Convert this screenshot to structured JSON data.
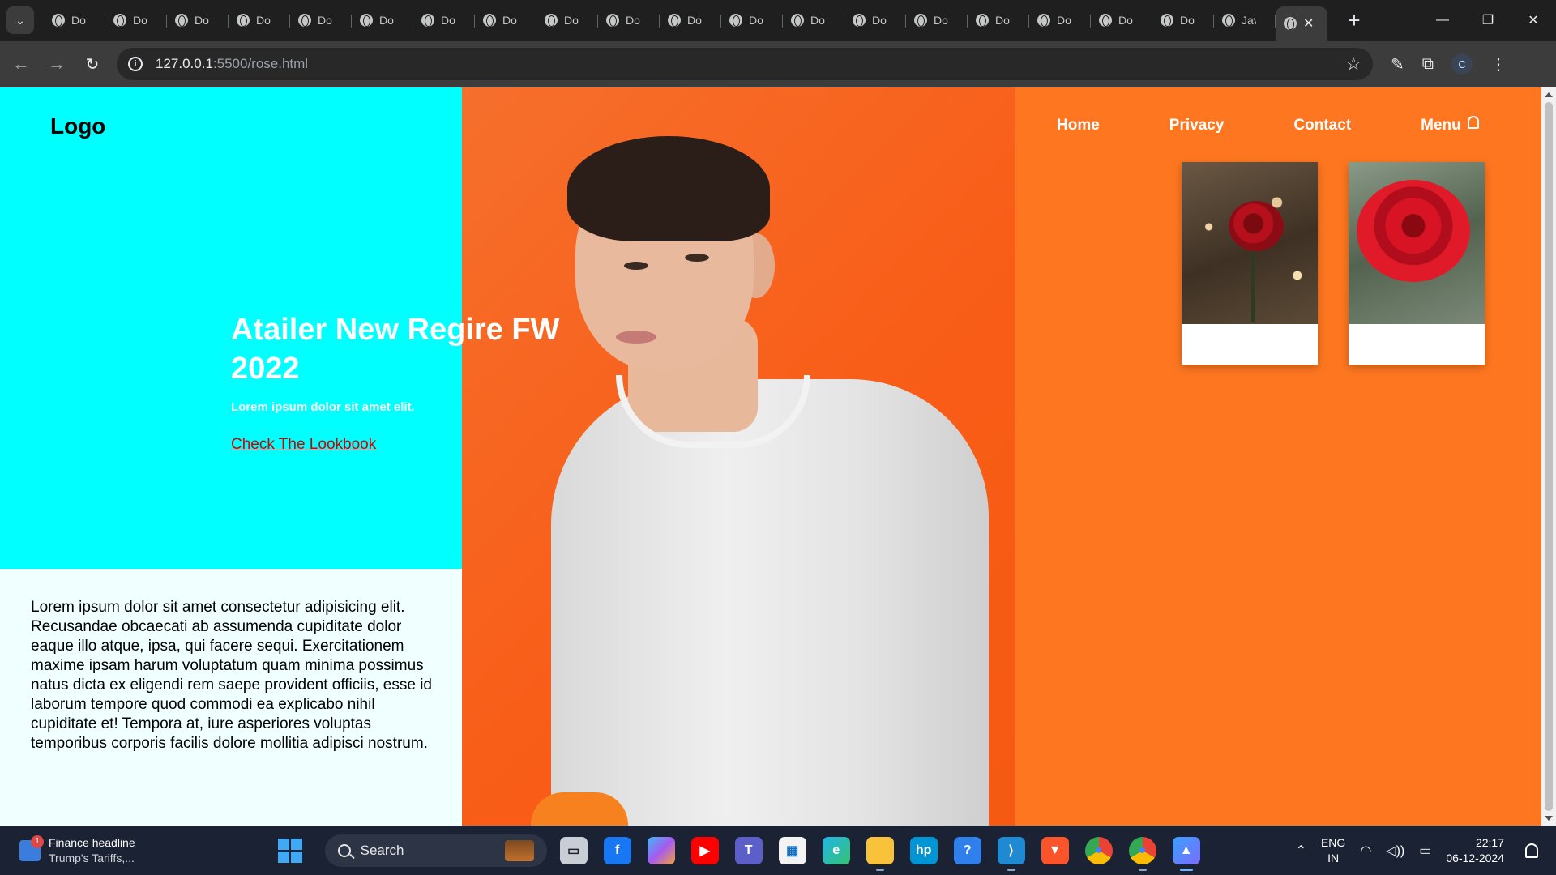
{
  "browser": {
    "tabs": [
      {
        "label": "Do"
      },
      {
        "label": "Do"
      },
      {
        "label": "Do"
      },
      {
        "label": "Do"
      },
      {
        "label": "Do"
      },
      {
        "label": "Do"
      },
      {
        "label": "Do"
      },
      {
        "label": "Do"
      },
      {
        "label": "Do"
      },
      {
        "label": "Do"
      },
      {
        "label": "Do"
      },
      {
        "label": "Do"
      },
      {
        "label": "Do"
      },
      {
        "label": "Do"
      },
      {
        "label": "Do"
      },
      {
        "label": "Do"
      },
      {
        "label": "Do"
      },
      {
        "label": "Do"
      },
      {
        "label": "Do"
      },
      {
        "label": "Jav"
      }
    ],
    "active_tab_close": "✕",
    "new_tab": "+",
    "url_host": "127.0.0.1",
    "url_rest": ":5500/rose.html",
    "profile_initial": "C"
  },
  "page": {
    "logo": "Logo",
    "nav": {
      "home": "Home",
      "privacy": "Privacy",
      "contact": "Contact",
      "menu": "Menu"
    },
    "hero": {
      "title": "Atailer New Regire FW 2022",
      "subtitle": "Lorem ipsum dolor sit amet elit.",
      "link": "Check The Lookbook"
    },
    "paragraph": "Lorem ipsum dolor sit amet consectetur adipisicing elit. Recusandae obcaecati ab assumenda cupiditate dolor eaque illo atque, ipsa, qui facere sequi. Exercitationem maxime ipsam harum voluptatum quam minima possimus natus dicta ex eligendi rem saepe provident officiis, esse id laborum tempore quod commodi ea explicabo nihil cupiditate et! Tempora at, iure asperiores voluptas temporibus corporis facilis dolore mollitia adipisci nostrum.",
    "colors": {
      "cyan": "#00ffff",
      "orange": "#fe7720",
      "link_red": "#d10000"
    }
  },
  "taskbar": {
    "widget_title": "Finance headline",
    "widget_sub": "Trump's Tariffs,...",
    "widget_badge": "1",
    "search_label": "Search",
    "lang_top": "ENG",
    "lang_bottom": "IN",
    "time": "22:17",
    "date": "06-12-2024",
    "apps": [
      {
        "name": "task-view-icon"
      },
      {
        "name": "facebook-icon"
      },
      {
        "name": "copilot-icon"
      },
      {
        "name": "youtube-icon"
      },
      {
        "name": "teams-icon"
      },
      {
        "name": "store-icon"
      },
      {
        "name": "edge-icon"
      },
      {
        "name": "file-explorer-icon"
      },
      {
        "name": "myhp-icon"
      },
      {
        "name": "help-icon"
      },
      {
        "name": "vscode-icon"
      },
      {
        "name": "brave-icon"
      },
      {
        "name": "chrome-icon"
      },
      {
        "name": "chrome-profile-icon"
      },
      {
        "name": "photos-icon"
      }
    ]
  }
}
